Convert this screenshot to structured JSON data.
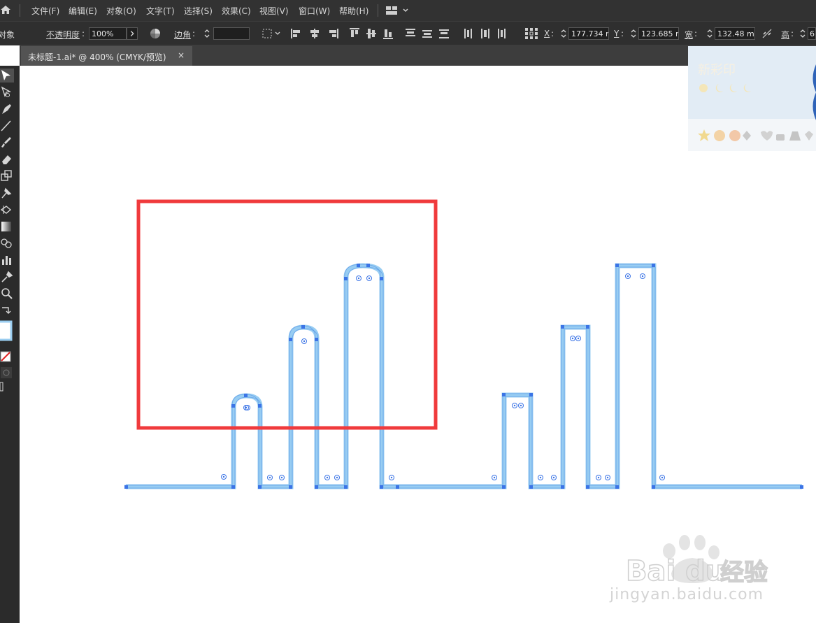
{
  "menu": {
    "items": [
      "文件(F)",
      "编辑(E)",
      "对象(O)",
      "文字(T)",
      "选择(S)",
      "效果(C)",
      "视图(V)",
      "窗口(W)",
      "帮助(H)"
    ]
  },
  "control": {
    "object_label": "对象",
    "opacity_label": "不透明度",
    "opacity_value": "100%",
    "corner_label": "边角",
    "x_label": "X",
    "x_value": "177.734 m",
    "y_label": "Y",
    "y_value": "123.685 m",
    "w_label": "宽",
    "w_value": "132.48 mm",
    "h_label": "高",
    "h_value": "6"
  },
  "document": {
    "tab_title": "未标题-1.ai* @ 400% (CMYK/预览)",
    "close_glyph": "×"
  },
  "ad": {
    "brand": "新彩印"
  },
  "watermark": {
    "text": "jingyan.baidu.com"
  },
  "colors": {
    "path_stroke": "#98cdf2",
    "anchor": "#3b74e6",
    "highlight_box": "#f03a3c",
    "ui_dark": "#323232"
  }
}
